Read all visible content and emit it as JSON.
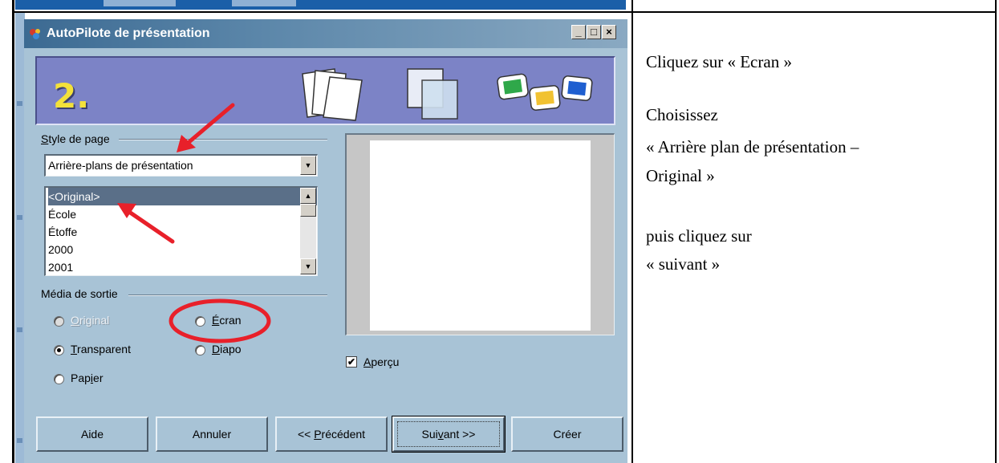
{
  "window": {
    "title": "AutoPilote de présentation",
    "controls": [
      "_",
      "□",
      "×"
    ]
  },
  "banner": {
    "step_number": "2."
  },
  "page_style": {
    "label_pre": "",
    "label_access_key": "S",
    "label_post": "tyle de page",
    "selected_value": "Arrière-plans de présentation",
    "items": [
      "<Original>",
      "École",
      "Étoffe",
      "2000",
      "2001"
    ],
    "selected_item": "<Original>"
  },
  "output_media": {
    "label": "Média de sortie",
    "options": [
      {
        "pre": "",
        "key": "O",
        "post": "riginal",
        "checked": false,
        "disabled": true
      },
      {
        "pre": "",
        "key": "É",
        "post": "cran",
        "checked": false,
        "disabled": false
      },
      {
        "pre": "",
        "key": "T",
        "post": "ransparent",
        "checked": true,
        "disabled": false
      },
      {
        "pre": "",
        "key": "D",
        "post": "iapo",
        "checked": false,
        "disabled": false
      },
      {
        "pre": "Pap",
        "key": "i",
        "post": "er",
        "checked": false,
        "disabled": false
      }
    ]
  },
  "preview_checkbox": {
    "pre": "",
    "key": "A",
    "post": "perçu",
    "checked": true
  },
  "buttons": {
    "help": "Aide",
    "cancel": "Annuler",
    "previous_pre": "<< ",
    "previous_key": "P",
    "previous_post": "récédent",
    "next_pre": "Sui",
    "next_key": "v",
    "next_post": "ant >>",
    "create": "Créer"
  },
  "instructions": {
    "line1": "Cliquez sur « Ecran »",
    "line2": "Choisissez",
    "line3": "« Arrière plan de présentation –",
    "line4": "Original »",
    "line5": "puis cliquez sur",
    "line6": "« suivant »"
  },
  "colors": {
    "annotation_red": "#e8202a",
    "dialog_bg": "#a8c3d6",
    "titlebar": "#3c6a92",
    "banner": "#7c83c6"
  }
}
